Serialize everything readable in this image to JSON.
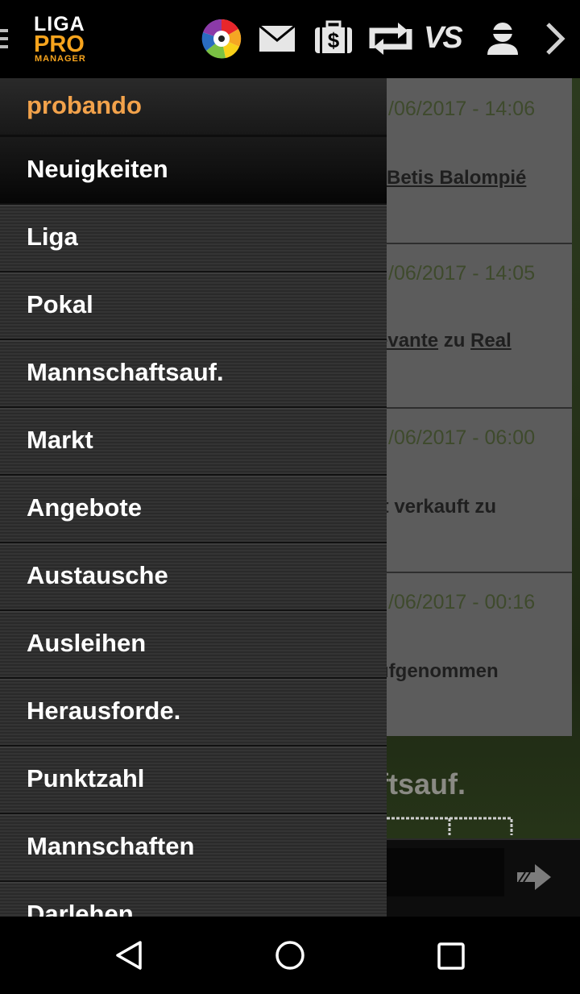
{
  "app": {
    "logo": {
      "line1": "LIGA",
      "line2": "PRO",
      "line3": "MANAGER"
    },
    "toolbar_icons": [
      "laliga-icon",
      "mail-icon",
      "money-briefcase-icon",
      "exchange-icon",
      "vs-icon",
      "user-icon",
      "chevron-right-icon"
    ],
    "toolbar_labels": {
      "vs": "VS"
    }
  },
  "drawer": {
    "username": "probando",
    "items": [
      {
        "label": "Neuigkeiten",
        "active": true
      },
      {
        "label": "Liga"
      },
      {
        "label": "Pokal"
      },
      {
        "label": "Mannschaftsauf."
      },
      {
        "label": "Markt"
      },
      {
        "label": "Angebote"
      },
      {
        "label": "Austausche"
      },
      {
        "label": "Ausleihen"
      },
      {
        "label": "Herausforde."
      },
      {
        "label": "Punktzahl"
      },
      {
        "label": "Mannschaften"
      },
      {
        "label": "Darlehen"
      }
    ]
  },
  "news": [
    {
      "date": "/06/2017 - 14:06",
      "text_pre": "",
      "link1": "Betis Balompié",
      "text_mid": "",
      "link2": ""
    },
    {
      "date": "/06/2017 - 14:05",
      "text_pre": "",
      "link1": "evante",
      "text_mid": " zu ",
      "link2": "Real"
    },
    {
      "date": "/06/2017 - 06:00",
      "text_pre": "it verkauft zu",
      "link1": "",
      "text_mid": "",
      "link2": ""
    },
    {
      "date": "/06/2017 - 00:16",
      "text_pre": "ufgenommen",
      "link1": "",
      "text_mid": "",
      "link2": ""
    }
  ],
  "section_title": "ftsauf.",
  "colors": {
    "accent": "#f2a24b",
    "brand_orange": "#f7a41d"
  }
}
